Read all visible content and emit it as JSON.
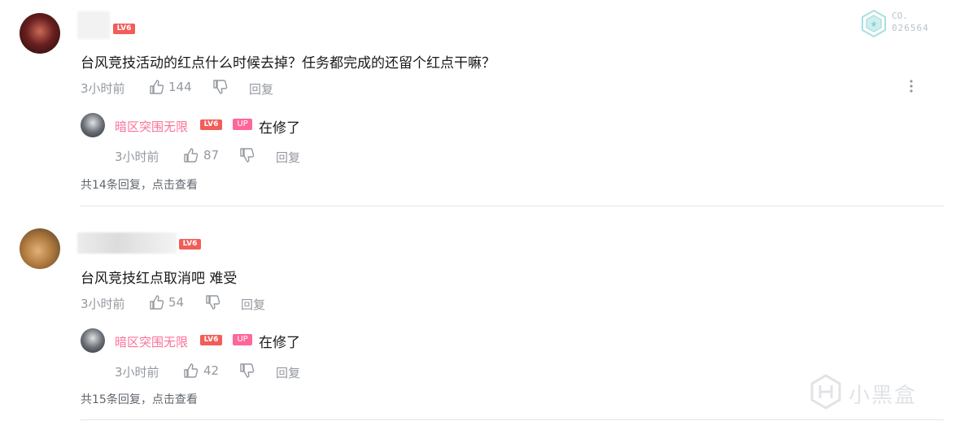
{
  "badge": {
    "co": "CO.",
    "code": "026564"
  },
  "comments": [
    {
      "level": "LV6",
      "text": "台风竞技活动的红点什么时候去掉？任务都完成的还留个红点干嘛？",
      "time": "3小时前",
      "likes": "144",
      "reply_label": "回复",
      "reply": {
        "user": "暗区突围无限",
        "level": "LV6",
        "up": "UP",
        "text": "在修了",
        "time": "3小时前",
        "likes": "87",
        "reply_label": "回复"
      },
      "more_replies": "共14条回复，点击查看"
    },
    {
      "level": "LV6",
      "text": "台风竞技红点取消吧 难受",
      "time": "3小时前",
      "likes": "54",
      "reply_label": "回复",
      "reply": {
        "user": "暗区突围无限",
        "level": "LV6",
        "up": "UP",
        "text": "在修了",
        "time": "3小时前",
        "likes": "42",
        "reply_label": "回复"
      },
      "more_replies": "共15条回复，点击查看"
    }
  ],
  "watermark": {
    "text": "小黑盒"
  }
}
